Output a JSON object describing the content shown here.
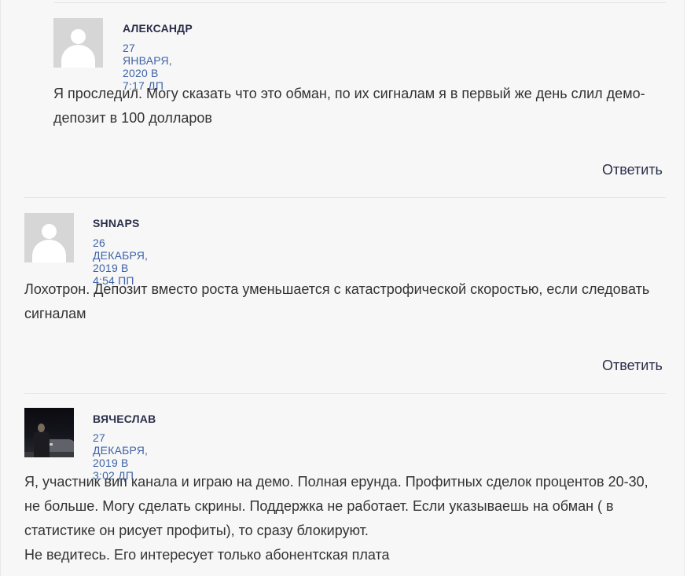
{
  "comments": [
    {
      "author": "АЛЕКСАНДР",
      "date": "27 ЯНВАРЯ, 2020 В 7:17 ДП",
      "text": [
        "Я проследил. Могу сказать что это обман, по их сигналам я в первый же день слил демо-депозит в 100 долларов"
      ],
      "reply_label": "Ответить",
      "avatar_icon": "default-avatar-icon"
    },
    {
      "author": "SHNAPS",
      "date": "26 ДЕКАБРЯ, 2019 В 4:54 ПП",
      "text": [
        "Лохотрон. Депозит вместо роста уменьшается с катастрофической скоростью, если следовать сигналам"
      ],
      "reply_label": "Ответить",
      "avatar_icon": "default-avatar-icon"
    },
    {
      "author": "ВЯЧЕСЛАВ",
      "date": "27 ДЕКАБРЯ, 2019 В 3:02 ДП",
      "text": [
        "Я, участник вип канала и играю на демо. Полная ерунда. Профитных сделок процентов 20-30, не больше. Могу сделать скрины. Поддержка не работает. Если указываешь на обман ( в статистике он рисует профиты), то сразу блокируют.",
        "Не ведитесь. Его интересует только абонентская плата"
      ],
      "avatar_icon": "user-photo-avatar"
    }
  ],
  "colors": {
    "author": "#2a2f49",
    "date": "#3e63a8",
    "text": "#333333",
    "background": "#f7f7f7"
  }
}
